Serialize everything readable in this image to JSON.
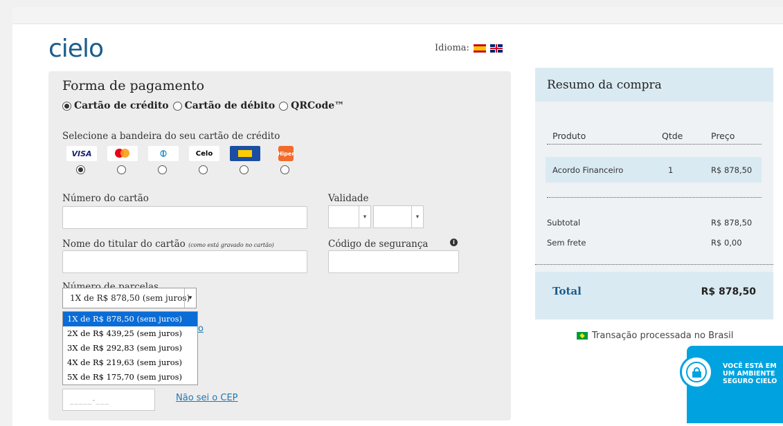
{
  "header": {
    "logo": "cielo",
    "language_label": "Idioma:",
    "flags": [
      "spain-flag-icon",
      "uk-flag-icon"
    ]
  },
  "payment": {
    "title": "Forma de pagamento",
    "methods": [
      {
        "label": "Cartão de crédito",
        "selected": true
      },
      {
        "label": "Cartão de débito",
        "selected": false
      },
      {
        "label": "QRCode™",
        "selected": false
      }
    ],
    "brand_prompt": "Selecione a bandeira do seu cartão de crédito",
    "brands": [
      {
        "name": "visa",
        "label": "VISA",
        "selected": true
      },
      {
        "name": "mastercard",
        "label": "",
        "selected": false
      },
      {
        "name": "diners",
        "label": "",
        "selected": false
      },
      {
        "name": "elo",
        "label": "elo",
        "selected": false
      },
      {
        "name": "aura",
        "label": "",
        "selected": false
      },
      {
        "name": "hipercard",
        "label": "Hiper",
        "selected": false
      }
    ],
    "card_number_label": "Número do cartão",
    "card_number_value": "",
    "expiry_label": "Validade",
    "expiry_month": "",
    "expiry_year": "",
    "holder_label": "Nome do titular do cartão",
    "holder_hint": "(como está gravado no cartão)",
    "holder_value": "",
    "cvv_label": "Código de segurança",
    "cvv_value": "",
    "installments_label": "Número de parcelas",
    "installments_selected": "1X de R$ 878,50 (sem juros)",
    "installment_options": [
      "1X de R$ 878,50 (sem juros)",
      "2X de R$ 439,25 (sem juros)",
      "3X de R$ 292,83 (sem juros)",
      "4X de R$ 219,63 (sem juros)",
      "5X de R$ 175,70 (sem juros)"
    ],
    "partially_hidden_link": "o",
    "cep_placeholder": "_____-___",
    "cep_link": "Não sei o CEP"
  },
  "summary": {
    "title": "Resumo da compra",
    "columns": [
      "Produto",
      "Qtde",
      "Preço"
    ],
    "items": [
      {
        "product": "Acordo Financeiro",
        "qty": "1",
        "price": "R$ 878,50"
      }
    ],
    "subtotal_label": "Subtotal",
    "subtotal_value": "R$ 878,50",
    "shipping_label": "Sem frete",
    "shipping_value": "R$ 0,00",
    "total_label": "Total",
    "total_value": "R$ 878,50"
  },
  "footer": {
    "processed_text": "Transação processada no Brasil",
    "secure_lines": [
      "VOCÊ ESTÁ EM",
      "UM AMBIENTE",
      "SEGURO CIELO"
    ]
  },
  "colors": {
    "brand_blue": "#1a5d8f",
    "link": "#1f76b3",
    "secure_badge": "#00a3e0",
    "dropdown_highlight": "#0a6cd6"
  }
}
